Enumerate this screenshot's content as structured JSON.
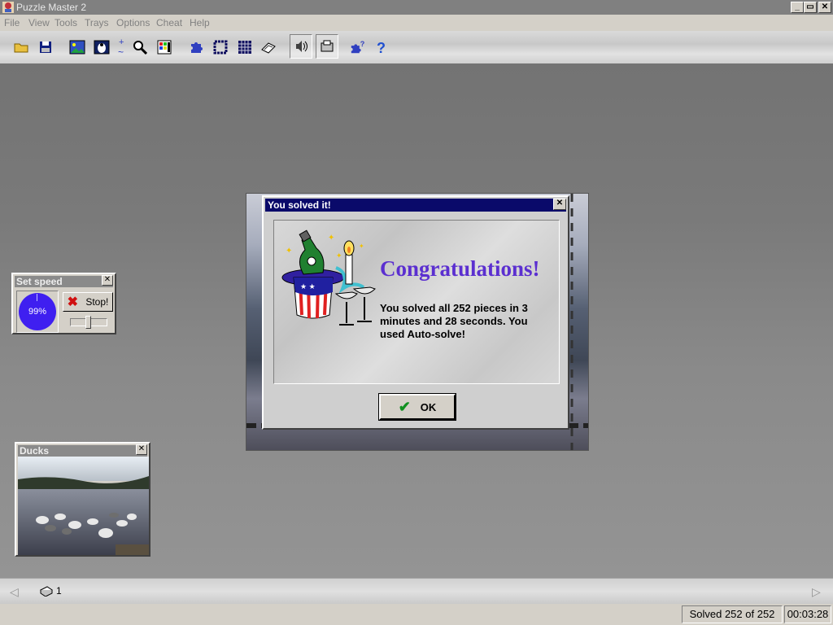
{
  "window": {
    "title": "Puzzle Master 2"
  },
  "menu": [
    "File",
    "View",
    "Tools",
    "Trays",
    "Options",
    "Cheat",
    "Help"
  ],
  "toolbar_icons": [
    "open-folder-icon",
    "save-disk-icon",
    "picture-icon",
    "penguin-picture-icon",
    "zoom-in-out-icon",
    "magnify-icon",
    "palette-icon",
    "puzzle-piece-icon",
    "edge-pieces-icon",
    "grid-icon",
    "scatter-icon",
    "sound-icon",
    "tray-icon",
    "piece-hint-icon",
    "help-icon"
  ],
  "speed_window": {
    "title": "Set speed",
    "percent": "99%",
    "stop_label": "Stop!"
  },
  "preview_window": {
    "title": "Ducks"
  },
  "dialog": {
    "title": "You solved it!",
    "heading": "Congratulations!",
    "message": "You solved all 252 pieces in 3 minutes and 28 seconds. You used Auto-solve!",
    "ok_label": "OK"
  },
  "tray": {
    "count": "1"
  },
  "status": {
    "solved": "Solved 252 of 252",
    "time": "00:03:28"
  },
  "colors": {
    "dialog_title_bg": "#0a0a6a",
    "heading": "#5b2fd0",
    "speed_dial": "#3f1ff0"
  }
}
